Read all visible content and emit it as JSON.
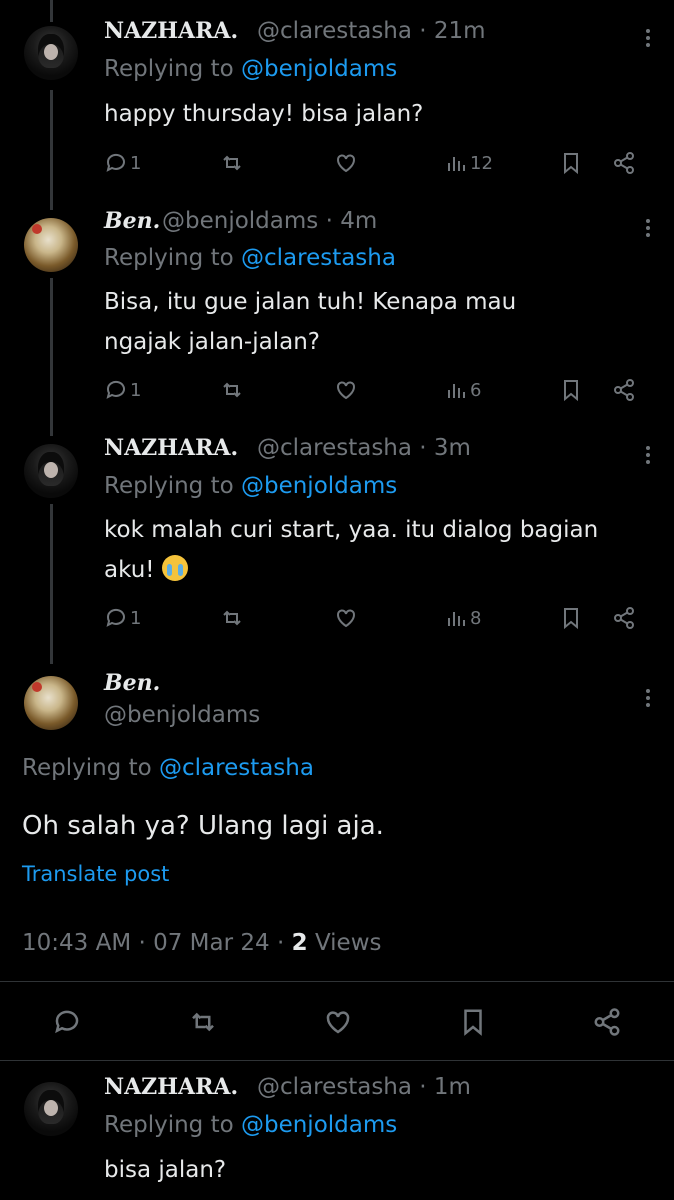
{
  "posts": [
    {
      "name": "NAZHARA.",
      "handle": "@clarestasha · 21m",
      "replying_prefix": "Replying to ",
      "replying_to": "@benjoldams",
      "text": "happy thursday! bisa jalan?",
      "replies": "1",
      "views": "12"
    },
    {
      "name": "Ben.",
      "handle": "@benjoldams · 4m",
      "replying_prefix": "Replying to ",
      "replying_to": "@clarestasha",
      "text_line1": "Bisa, itu gue jalan tuh! Kenapa mau",
      "text_line2": "ngajak jalan-jalan?",
      "replies": "1",
      "views": "6"
    },
    {
      "name": "NAZHARA.",
      "handle": "@clarestasha · 3m",
      "replying_prefix": "Replying to ",
      "replying_to": "@benjoldams",
      "text_line1": "kok malah curi start, yaa. itu dialog bagian",
      "text_line2": "aku! ",
      "emoji": "loudly-crying-face",
      "replies": "1",
      "views": "8"
    }
  ],
  "main": {
    "name": "Ben.",
    "handle": "@benjoldams",
    "replying_prefix": "Replying to ",
    "replying_to": "@clarestasha",
    "text": "Oh salah ya? Ulang lagi aja.",
    "translate": "Translate post",
    "time": "10:43 AM",
    "date": "07 Mar 24",
    "views_count": "2",
    "views_label": "Views"
  },
  "last": {
    "name": "NAZHARA.",
    "handle": "@clarestasha · 1m",
    "replying_prefix": "Replying to ",
    "replying_to": "@benjoldams",
    "text": "bisa jalan?"
  },
  "colors": {
    "accent": "#1d9bf0",
    "muted": "#71767b",
    "text": "#e7e9ea",
    "bg": "#000000"
  }
}
